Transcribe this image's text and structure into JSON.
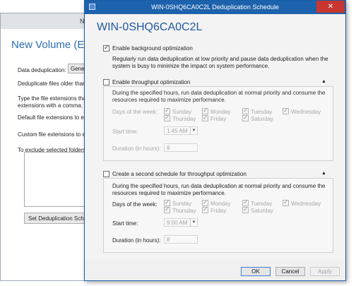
{
  "background_window": {
    "title_fragment": "N",
    "heading": "New Volume (E:\\)",
    "dedup_label": "Data deduplication:",
    "general_button": "General purpose file server",
    "files_older": "Deduplicate files older than (in days):",
    "type_ext_1": "Type the file extensions that you want to exclude from data deduplication. Separate",
    "type_ext_2": "extensions with a comma. For example: doc,txt,png",
    "default_ext": "Default file extensions to exclude:",
    "custom_ext": "Custom file extensions to exclude:",
    "exclude_folders": "To exclude selected folders (and files), ...",
    "set_schedule_button": "Set Deduplication Schedule..."
  },
  "dialog": {
    "title": "WIN-0SHQ6CA0C2L Deduplication Schedule",
    "server_name": "WIN-0SHQ6CA0C2L",
    "background_opt": {
      "label": "Enable background optimization",
      "checked": true,
      "description": "Regularly run data deduplication at low priority and pause data deduplication when the system is busy to minimize the impact on system performance."
    },
    "throughput": {
      "label": "Enable throughput optimization",
      "checked": false,
      "description": "During the specified hours, run data deduplication at normal priority and consume the resources required to maximize performance.",
      "days_label": "Days of the week:",
      "days": {
        "sunday": "Sunday",
        "monday": "Monday",
        "tuesday": "Tuesday",
        "wednesday": "Wednesday",
        "thursday": "Thursday",
        "friday": "Friday",
        "saturday": "Saturday"
      },
      "start_label": "Start time:",
      "start_value": "1:45 AM",
      "duration_label": "Duration (in hours):",
      "duration_value": "6"
    },
    "second_schedule": {
      "label": "Create a second schedule for throughput optimization",
      "checked": false,
      "description": "During the specified hours, run data deduplication at normal priority and consume the resources required to maximize performance.",
      "days_label": "Days of the week:",
      "days": {
        "sunday": "Sunday",
        "monday": "Monday",
        "tuesday": "Tuesday",
        "wednesday": "Wednesday",
        "thursday": "Thursday",
        "friday": "Friday",
        "saturday": "Saturday"
      },
      "start_label": "Start time:",
      "start_value": "9:00 AM",
      "duration_label": "Duration (in hours):",
      "duration_value": "8"
    },
    "buttons": {
      "ok": "OK",
      "cancel": "Cancel",
      "apply": "Apply"
    }
  },
  "colors": {
    "titlebar": "#1d62ac",
    "heading": "#1f5aa0",
    "close": "#c7372f"
  },
  "icons": {
    "close": "close-icon",
    "collapse": "chevron-up-icon",
    "dropdown": "chevron-down-icon"
  }
}
